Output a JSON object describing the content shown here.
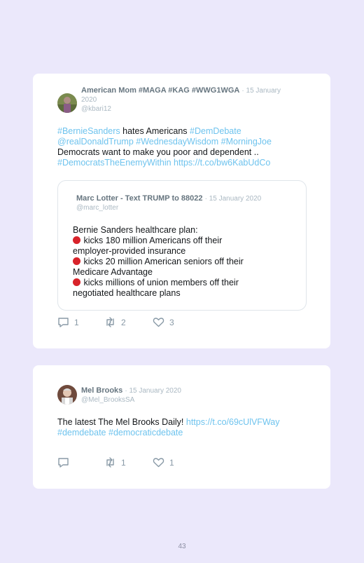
{
  "tweets": [
    {
      "author": "American Mom #MAGA #KAG #WWG1WGA",
      "date_line1": "· 15 January",
      "date_line2": "2020",
      "handle": "@kbari12",
      "text": [
        {
          "parts": [
            {
              "t": "#BernieSanders",
              "link": true
            },
            {
              "t": " hates Americans ",
              "link": false
            },
            {
              "t": "#DemDebate",
              "link": true
            }
          ]
        },
        {
          "parts": [
            {
              "t": "@realDonaldTrump",
              "link": true
            },
            {
              "t": " ",
              "link": false
            },
            {
              "t": "#WednesdayWisdom",
              "link": true
            },
            {
              "t": " ",
              "link": false
            },
            {
              "t": "#MorningJoe",
              "link": true
            }
          ]
        },
        {
          "parts": [
            {
              "t": "Democrats want to make you poor and dependent ..",
              "link": false
            }
          ]
        },
        {
          "parts": [
            {
              "t": "#DemocratsTheEnemyWithin",
              "link": true
            },
            {
              "t": " ",
              "link": false
            },
            {
              "t": "https://t.co/bw6KabUdCo",
              "link": true
            }
          ]
        }
      ],
      "quoted": {
        "author": "Marc Lotter - Text TRUMP to 88022",
        "date": "· 15 January 2020",
        "handle": "@marc_lotter",
        "lines": [
          "Bernie Sanders healthcare plan:",
          "kicks 180 million Americans off their",
          "employer-provided insurance",
          "kicks 20 million American seniors off their",
          "Medicare Advantage",
          "kicks millions of union members off their",
          "negotiated healthcare plans"
        ]
      },
      "replies": "1",
      "retweets": "2",
      "likes": "3"
    },
    {
      "author": "Mel Brooks",
      "date": "· 15 January 2020",
      "handle": "@Mel_BrooksSA",
      "text": [
        {
          "parts": [
            {
              "t": "The latest The Mel Brooks Daily! ",
              "link": false
            },
            {
              "t": "https://t.co/69cUlVFWay",
              "link": true
            }
          ]
        },
        {
          "parts": [
            {
              "t": "#demdebate",
              "link": true
            },
            {
              "t": " ",
              "link": false
            },
            {
              "t": "#democraticdebate",
              "link": true
            }
          ]
        }
      ],
      "replies": "",
      "retweets": "1",
      "likes": "1"
    }
  ],
  "page_number": "43",
  "icons": {
    "reply": "reply-icon",
    "retweet": "retweet-icon",
    "like": "heart-icon",
    "stop": "stop-sign-icon"
  },
  "colors": {
    "link": "#6ec3ee",
    "background": "#ebe8fb",
    "card": "#ffffff",
    "stop": "#d8232a"
  }
}
